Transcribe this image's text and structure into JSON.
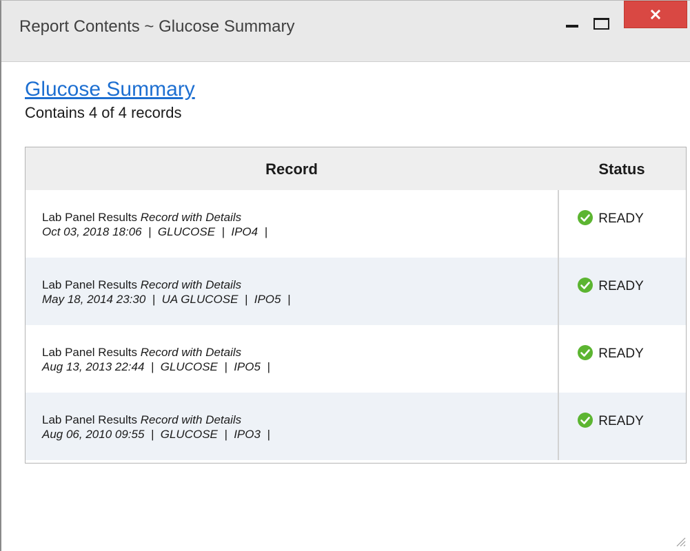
{
  "window": {
    "title": "Report Contents ~ Glucose Summary"
  },
  "report": {
    "link_label": "Glucose Summary",
    "subtitle": "Contains 4 of 4 records"
  },
  "table": {
    "headers": {
      "record": "Record",
      "status": "Status"
    },
    "rows": [
      {
        "type": "Lab Panel Results",
        "detail": "Record with Details",
        "date": "Oct 03, 2018 18:06",
        "test": "GLUCOSE",
        "site": "IPO4",
        "status": "READY"
      },
      {
        "type": "Lab Panel Results",
        "detail": "Record with Details",
        "date": "May 18, 2014 23:30",
        "test": "UA GLUCOSE",
        "site": "IPO5",
        "status": "READY"
      },
      {
        "type": "Lab Panel Results",
        "detail": "Record with Details",
        "date": "Aug 13, 2013 22:44",
        "test": "GLUCOSE",
        "site": "IPO5",
        "status": "READY"
      },
      {
        "type": "Lab Panel Results",
        "detail": "Record with Details",
        "date": "Aug 06, 2010 09:55",
        "test": "GLUCOSE",
        "site": "IPO3",
        "status": "READY"
      }
    ]
  },
  "icons": {
    "status": "check-circle-icon",
    "minimize": "minimize-icon",
    "maximize": "maximize-icon",
    "close": "close-icon",
    "resize": "resize-grip-icon"
  },
  "colors": {
    "link": "#1d6fd1",
    "close_button": "#d94843",
    "ready_badge": "#5cb531",
    "row_alt": "#eef2f7"
  }
}
